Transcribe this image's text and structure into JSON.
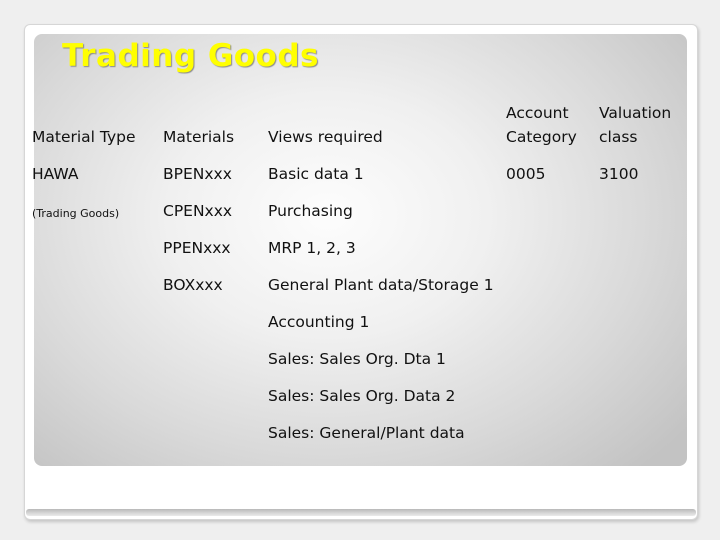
{
  "slide": {
    "title": "Trading Goods"
  },
  "table": {
    "headers": {
      "material_type": "Material Type",
      "materials": "Materials",
      "views_required": "Views required",
      "account_category_line1": "Account",
      "account_category_line2": "Category",
      "valuation_class_line1": "Valuation",
      "valuation_class_line2": "class"
    },
    "material_type": [
      "HAWA",
      "(Trading Goods)"
    ],
    "materials": [
      "BPENxxx",
      "CPENxxx",
      "PPENxxx",
      "BOXxxx"
    ],
    "views_required": [
      "Basic data 1",
      "Purchasing",
      "MRP 1, 2, 3",
      "General Plant data/Storage 1",
      "Accounting 1",
      "Sales: Sales Org. Dta 1",
      "Sales: Sales Org. Data 2",
      "Sales: General/Plant data"
    ],
    "account_category": "0005",
    "valuation_class": "3100"
  },
  "colors": {
    "title": "#ffff00",
    "text": "#111111"
  }
}
